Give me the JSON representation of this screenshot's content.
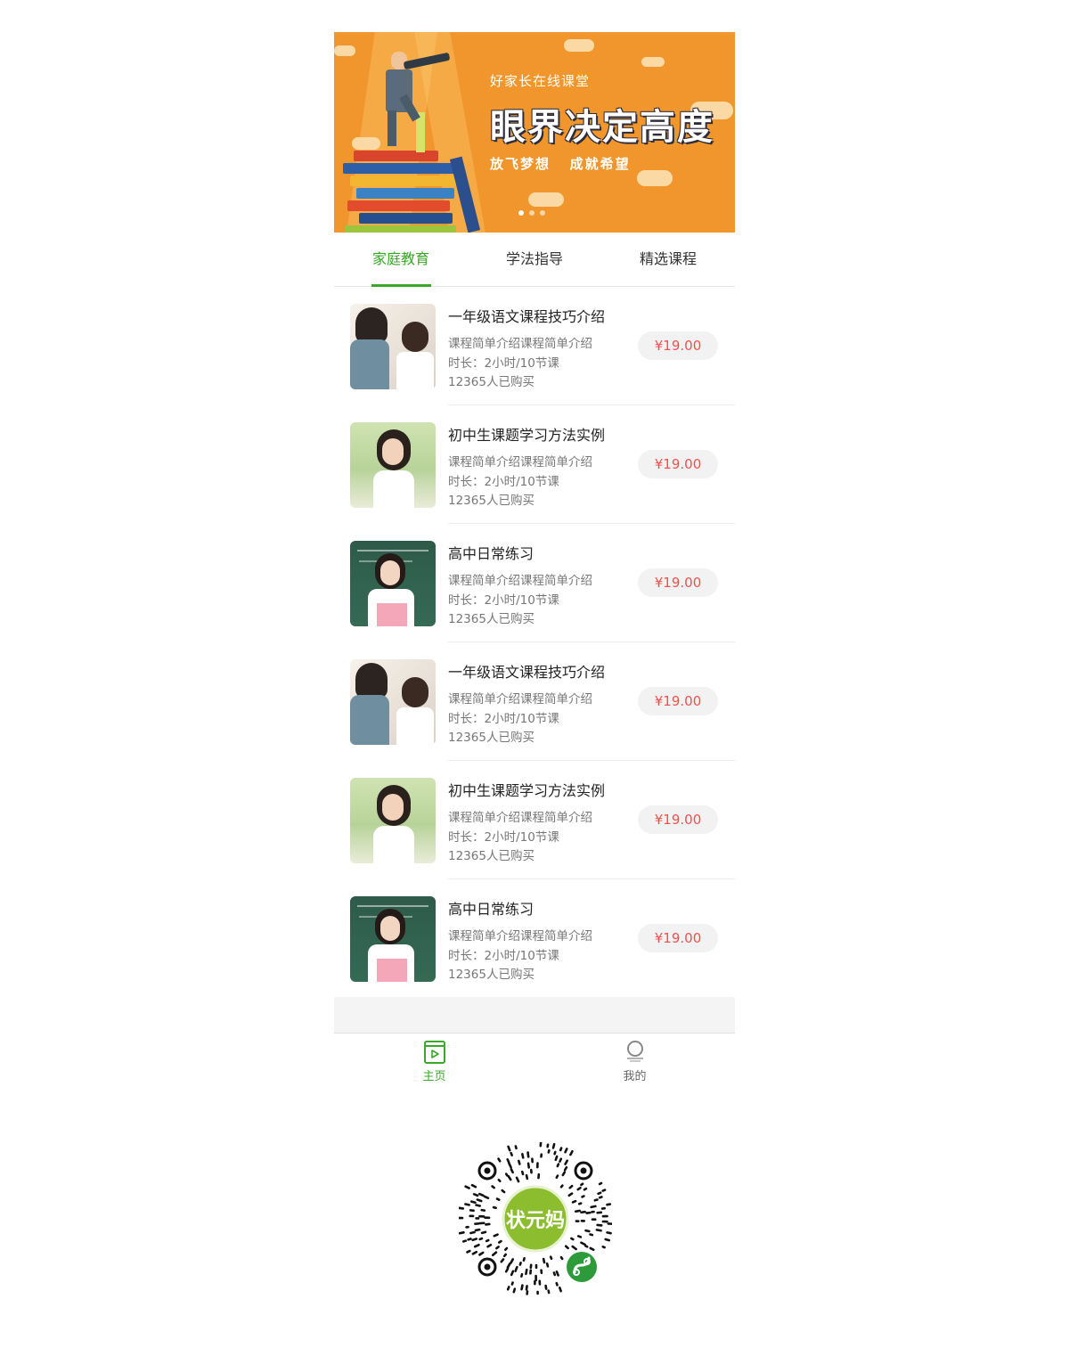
{
  "banner": {
    "subtitle": "好家长在线课堂",
    "title": "眼界决定高度",
    "slogan": "放飞梦想   成就希望",
    "dots": 3,
    "active_dot": 0
  },
  "tabs": [
    {
      "label": "家庭教育",
      "active": true
    },
    {
      "label": "学法指导",
      "active": false
    },
    {
      "label": "精选课程",
      "active": false
    }
  ],
  "courses": [
    {
      "title": "一年级语文课程技巧介绍",
      "desc": "课程简单介绍课程简单介绍",
      "duration": "时长：2小时/10节课",
      "buyers": "12365人已购买",
      "price": "¥19.00",
      "thumb": "teacher-and-child-photo"
    },
    {
      "title": "初中生课题学习方法实例",
      "desc": "课程简单介绍课程简单介绍",
      "duration": "时长：2小时/10节课",
      "buyers": "12365人已购买",
      "price": "¥19.00",
      "thumb": "schoolgirl-outdoor-photo"
    },
    {
      "title": "高中日常练习",
      "desc": "课程简单介绍课程简单介绍",
      "duration": "时长：2小时/10节课",
      "buyers": "12365人已购买",
      "price": "¥19.00",
      "thumb": "student-at-blackboard-photo"
    },
    {
      "title": "一年级语文课程技巧介绍",
      "desc": "课程简单介绍课程简单介绍",
      "duration": "时长：2小时/10节课",
      "buyers": "12365人已购买",
      "price": "¥19.00",
      "thumb": "teacher-and-child-photo"
    },
    {
      "title": "初中生课题学习方法实例",
      "desc": "课程简单介绍课程简单介绍",
      "duration": "时长：2小时/10节课",
      "buyers": "12365人已购买",
      "price": "¥19.00",
      "thumb": "schoolgirl-outdoor-photo"
    },
    {
      "title": "高中日常练习",
      "desc": "课程简单介绍课程简单介绍",
      "duration": "时长：2小时/10节课",
      "buyers": "12365人已购买",
      "price": "¥19.00",
      "thumb": "student-at-blackboard-photo"
    }
  ],
  "tabbar": [
    {
      "label": "主页",
      "icon": "home-play-icon",
      "active": true
    },
    {
      "label": "我的",
      "icon": "profile-icon",
      "active": false
    }
  ],
  "qr": {
    "center_text": "状元妈"
  },
  "colors": {
    "accent": "#3aa62a",
    "price": "#f25050",
    "banner": "#f0962c"
  }
}
